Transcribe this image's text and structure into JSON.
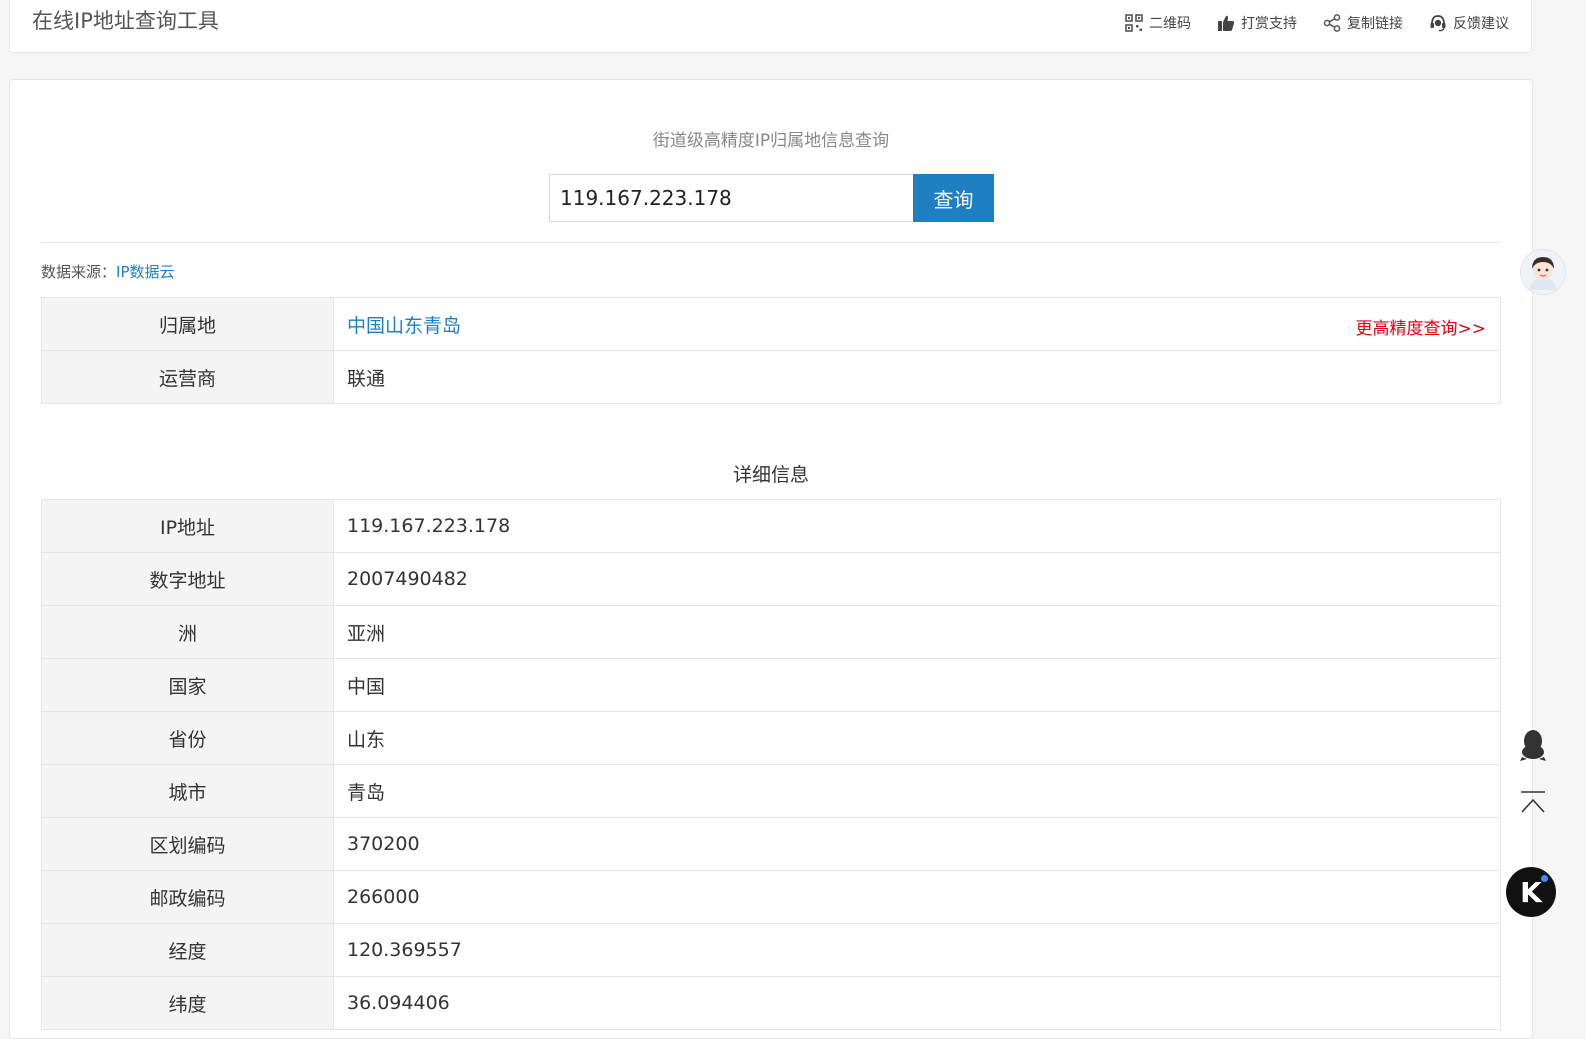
{
  "header": {
    "title": "在线IP地址查询工具",
    "tools": [
      {
        "label": "二维码",
        "icon": "qrcode-icon"
      },
      {
        "label": "打赏支持",
        "icon": "thumbs-up-icon"
      },
      {
        "label": "复制链接",
        "icon": "share-icon"
      },
      {
        "label": "反馈建议",
        "icon": "headset-icon"
      }
    ]
  },
  "search": {
    "subtitle": "街道级高精度IP归属地信息查询",
    "value": "119.167.223.178",
    "button_label": "查询"
  },
  "source": {
    "label": "数据来源：",
    "link": "IP数据云"
  },
  "summary": {
    "rows": [
      {
        "key": "归属地",
        "value": "中国山东青岛",
        "action": "更高精度查询>>"
      },
      {
        "key": "运营商",
        "value": "联通"
      }
    ]
  },
  "details": {
    "title": "详细信息",
    "rows": [
      {
        "key": "IP地址",
        "value": "119.167.223.178"
      },
      {
        "key": "数字地址",
        "value": "2007490482"
      },
      {
        "key": "洲",
        "value": "亚洲"
      },
      {
        "key": "国家",
        "value": "中国"
      },
      {
        "key": "省份",
        "value": "山东"
      },
      {
        "key": "城市",
        "value": "青岛"
      },
      {
        "key": "区划编码",
        "value": "370200"
      },
      {
        "key": "邮政编码",
        "value": "266000"
      },
      {
        "key": "经度",
        "value": "120.369557"
      },
      {
        "key": "纬度",
        "value": "36.094406"
      }
    ]
  },
  "side": {
    "k_letter": "K"
  },
  "colors": {
    "accent": "#1e7fc1",
    "link_red": "#e60012",
    "key_bg": "#f4f4f4"
  }
}
